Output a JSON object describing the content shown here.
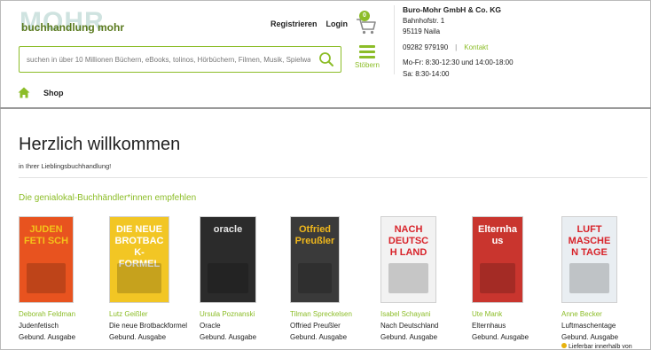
{
  "logo": {
    "big": "MOHR",
    "small": "buchhandlung mohr"
  },
  "header": {
    "register": "Registrieren",
    "login": "Login",
    "cart_count": "0",
    "search_placeholder": "suchen in über 10 Millionen Büchern, eBooks, tolinos, Hörbüchern, Filmen, Musik, Spielwaren",
    "menu_label": "Stöbern"
  },
  "store": {
    "name": "Buro-Mohr GmbH & Co. KG",
    "street": "Bahnhofstr. 1",
    "city": "95119 Naila",
    "phone": "09282 979190",
    "sep": "|",
    "contact": "Kontakt",
    "hours1": "Mo-Fr: 8:30-12:30 und 14:00-18:00",
    "hours2": "Sa: 8:30-14:00"
  },
  "nav": {
    "shop": "Shop"
  },
  "main": {
    "welcome": "Herzlich willkommen",
    "subtitle": "in Ihrer Lieblingsbuchhandlung!",
    "recommend": "Die genialokal-Buchhändler*innen empfehlen"
  },
  "books": [
    {
      "author": "Deborah Feldman",
      "title": "Judenfetisch",
      "format": "Gebund. Ausgabe",
      "cover_bg": "#e8531f",
      "cover_text": "JUDEN FETI SCH",
      "cover_color": "#f4c21a"
    },
    {
      "author": "Lutz Geißler",
      "title": "Die neue Brotbackformel",
      "format": "Gebund. Ausgabe",
      "cover_bg": "#f2c624",
      "cover_text": "DIE NEUE BROTBACK-FORMEL",
      "cover_color": "#ffffff"
    },
    {
      "author": "Ursula Poznanski",
      "title": "Oracle",
      "format": "Gebund. Ausgabe",
      "cover_bg": "#2b2b2b",
      "cover_text": "oracle",
      "cover_color": "#e6e6e6"
    },
    {
      "author": "Tilman Spreckelsen",
      "title": "Offried Preußler",
      "format": "Gebund. Ausgabe",
      "cover_bg": "#3a3a3a",
      "cover_text": "Otfried Preußler",
      "cover_color": "#f0b81c"
    },
    {
      "author": "Isabel Schayani",
      "title": "Nach Deutschland",
      "format": "Gebund. Ausgabe",
      "cover_bg": "#f2f2f2",
      "cover_text": "NACH DEUTSCH LAND",
      "cover_color": "#d8232a"
    },
    {
      "author": "Ute Mank",
      "title": "Elternhaus",
      "format": "Gebund. Ausgabe",
      "cover_bg": "#c9352e",
      "cover_text": "Elternhaus",
      "cover_color": "#ffffff"
    },
    {
      "author": "Anne Becker",
      "title": "Luftmaschentage",
      "format": "Gebund. Ausgabe",
      "cover_bg": "#e9eef2",
      "cover_text": "LUFT MASCHEN TAGE",
      "cover_color": "#d8232a",
      "availability": "Lieferbar innerhalb von"
    }
  ],
  "colors": {
    "accent": "#8cbd28",
    "rule": "#9a9a9a"
  }
}
